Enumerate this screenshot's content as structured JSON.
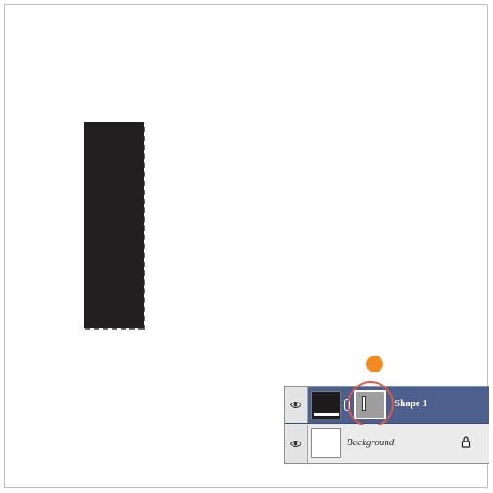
{
  "canvas": {
    "shape_color": "#221f20"
  },
  "step_badge": {
    "color": "#f28a22"
  },
  "layers": [
    {
      "name": "Shape 1",
      "selected": true,
      "icon": "eye-icon"
    },
    {
      "name": "Background",
      "selected": false,
      "icon": "eye-icon",
      "locked_icon": "lock-icon"
    }
  ],
  "colors": {
    "selected_row": "#4d5f8d",
    "highlight": "#e05a44"
  }
}
